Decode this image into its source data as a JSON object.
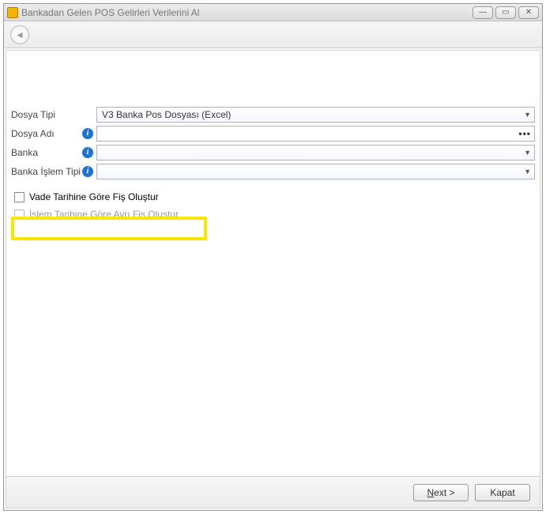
{
  "window": {
    "title": "Bankadan Gelen POS Gelirleri Verilerini Al"
  },
  "form": {
    "dosyaTipi": {
      "label": "Dosya Tipi",
      "value": "V3 Banka Pos Dosyası (Excel)"
    },
    "dosyaAdi": {
      "label": "Dosya Adı",
      "value": ""
    },
    "banka": {
      "label": "Banka",
      "value": ""
    },
    "bankaIslemTipi": {
      "label": "Banka İşlem Tipi",
      "value": ""
    },
    "checkbox1": {
      "label": "Vade Tarihine Göre Fiş Oluştur",
      "checked": false
    },
    "checkbox2": {
      "label": "İşlem Tarihine Göre Ayrı Fiş Oluştur",
      "checked": false
    }
  },
  "buttons": {
    "next": "Next >",
    "close": "Kapat"
  }
}
